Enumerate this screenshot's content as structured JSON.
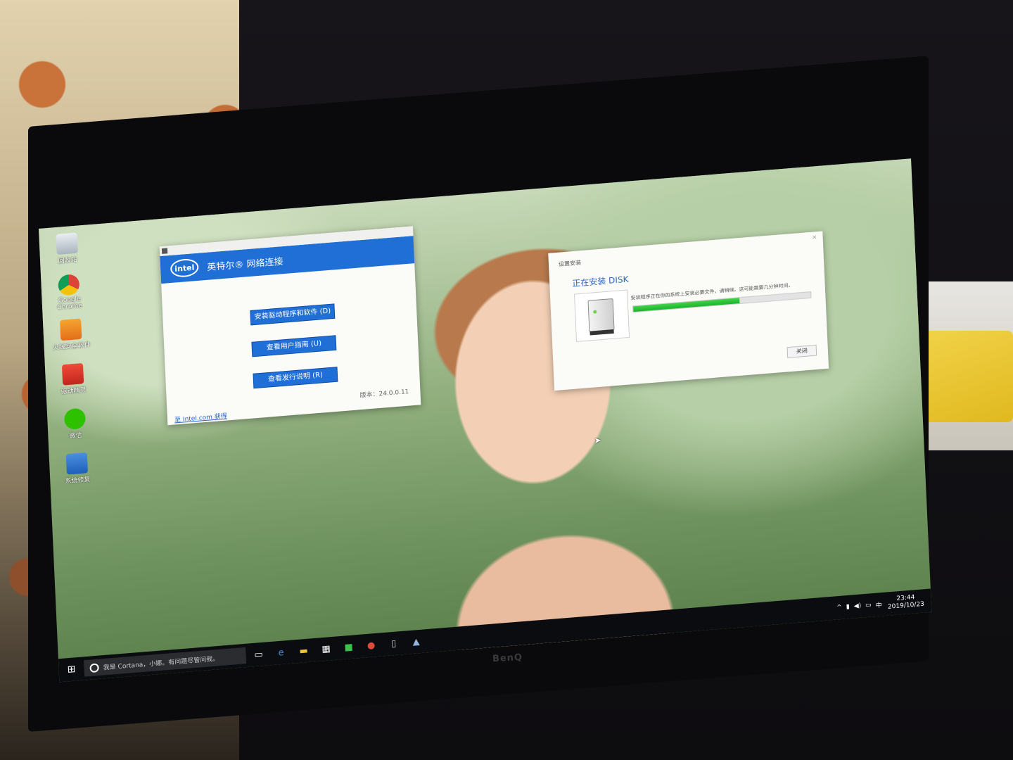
{
  "desktop": {
    "icons": [
      {
        "label": "回收站",
        "icon": "recycle-bin-icon"
      },
      {
        "label": "Google Chrome",
        "icon": "chrome-icon"
      },
      {
        "label": "火绒安全软件",
        "icon": "shield-icon"
      },
      {
        "label": "驱动精灵",
        "icon": "driver-tool-icon"
      },
      {
        "label": "微信",
        "icon": "wechat-icon"
      },
      {
        "label": "系统修复",
        "icon": "system-repair-icon"
      }
    ]
  },
  "intel_window": {
    "title": "英特尔® 网络连接",
    "logo": "intel",
    "buttons": [
      "安装驱动程序和软件 (D)",
      "查看用户指南 (U)",
      "查看发行说明 (R)"
    ],
    "version": "版本：24.0.0.11",
    "link": "至 Intel.com 获得"
  },
  "setup_window": {
    "title": "设置安装",
    "heading": "正在安装 DISK",
    "message": "安装程序正在你的系统上安装必要文件，请稍候。这可能需要几分钟时间。",
    "progress_percent": 60,
    "close_label": "关闭",
    "accent_color": "#22c03a"
  },
  "taskbar": {
    "start_icon": "windows-start-icon",
    "cortana_placeholder": "我是 Cortana，小娜。有问题尽管问我。",
    "apps": [
      "task-view-icon",
      "edge-icon",
      "file-explorer-icon",
      "store-icon",
      "installer-icon",
      "chrome-icon",
      "setup-icon",
      "photos-icon"
    ],
    "tray_lang": "中",
    "time": "23:44",
    "date": "2019/10/23"
  },
  "monitor": {
    "brand": "BenQ"
  }
}
